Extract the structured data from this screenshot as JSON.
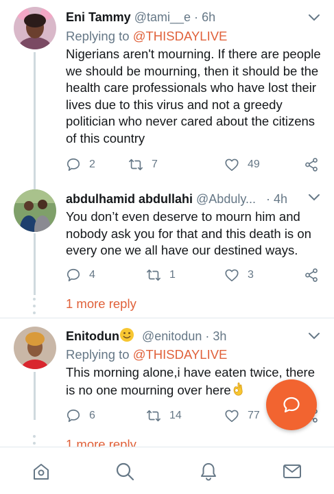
{
  "replies": [
    {
      "name": "Eni Tammy",
      "handle": "@tami__e",
      "sep": "·",
      "time": "6h",
      "replying_prefix": "Replying to",
      "replying_to": "@THISDAYLIVE",
      "text": "Nigerians aren't mourning. If there are people we should be mourning, then it should be the  health care professionals who have lost their lives due to this virus and not a greedy politician who never cared about the citizens of this country",
      "reply_count": "2",
      "retweet_count": "7",
      "like_count": "49"
    },
    {
      "name": "abdulhamid abdullahi",
      "handle": "@Abduly...",
      "sep": "·",
      "time": "4h",
      "text": "You don’t even deserve to mourn him and nobody ask you for that and this death is on every one we all have our destined ways.",
      "reply_count": "4",
      "retweet_count": "1",
      "like_count": "3",
      "more_replies": "1 more reply"
    },
    {
      "name": "Enitodun",
      "handle": "@enitodun",
      "sep": "·",
      "time": "3h",
      "replying_prefix": "Replying to",
      "replying_to": "@THISDAYLIVE",
      "text": "This morning alone,i have eaten twice, there is no one mourning over here",
      "reply_count": "6",
      "retweet_count": "14",
      "like_count": "77",
      "more_replies": "1 more reply"
    }
  ],
  "icons": {
    "reply": "reply-icon",
    "retweet": "retweet-icon",
    "like": "heart-icon",
    "share": "share-icon",
    "menu": "chevron-down-icon",
    "compose": "compose-reply-icon",
    "home": "home-icon",
    "search": "search-icon",
    "notifications": "bell-icon",
    "messages": "mail-icon"
  },
  "colors": {
    "accent": "#e0613a",
    "fab": "#f26430",
    "muted": "#657786",
    "text": "#14171a",
    "divider": "#e1e8ed"
  }
}
